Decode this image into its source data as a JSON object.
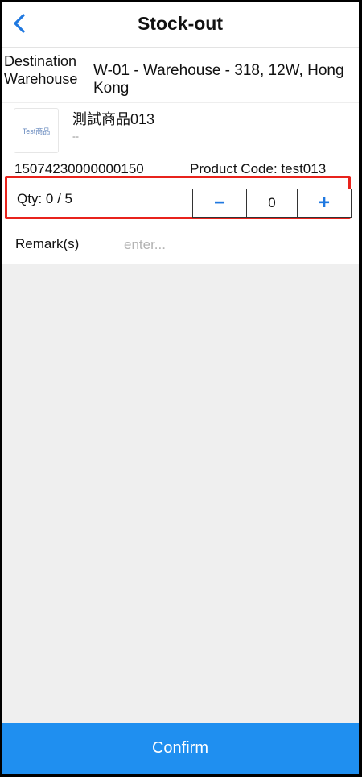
{
  "header": {
    "title": "Stock-out",
    "back_icon": "chevron-left-icon",
    "accent_color": "#1f78e0"
  },
  "destination": {
    "label": "Destination Warehouse",
    "value": "W-01 - Warehouse - 318, 12W, Hong Kong"
  },
  "product": {
    "thumbnail_text": "Test商品",
    "name": "測試商品013",
    "subtitle": "--",
    "barcode": "15074230000000150",
    "code_label": "Product Code: test013"
  },
  "quantity": {
    "label": "Qty: 0 / 5",
    "minus_symbol": "−",
    "plus_symbol": "+",
    "value": "0",
    "highlight_color": "#e8231c"
  },
  "remark": {
    "label": "Remark(s)",
    "placeholder": "enter..."
  },
  "footer": {
    "confirm_label": "Confirm",
    "button_color": "#1f8ff0"
  }
}
